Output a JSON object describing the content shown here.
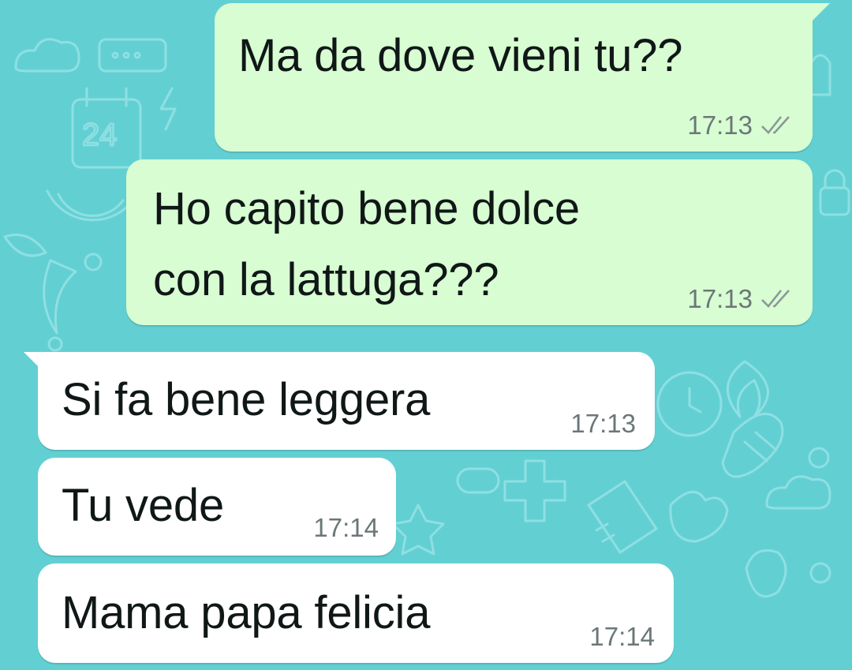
{
  "wallpaper": {
    "background": "#62d0d3",
    "doodle_color": "#8fdfe2",
    "doodles": [
      "calendar-icon",
      "cloud-icon",
      "lightning-icon",
      "watermelon-icon",
      "chili-icon",
      "clock-icon",
      "corn-icon",
      "baby-bottle-icon",
      "plus-icon",
      "flame-icon",
      "star-icon",
      "pill-icon",
      "cloud-icon",
      "hand-icon"
    ],
    "calendar_label": "24"
  },
  "messages": [
    {
      "direction": "outgoing",
      "text": "Ma da dove vieni tu??",
      "time": "17:13",
      "status": "read-double-check",
      "bubble_color": "#d8fdd2"
    },
    {
      "direction": "outgoing",
      "text_line1": "Ho capito bene dolce",
      "text_line2": "con la lattuga???",
      "time": "17:13",
      "status": "read-double-check",
      "bubble_color": "#d8fdd2"
    },
    {
      "direction": "incoming",
      "text": "Si fa bene leggera",
      "time": "17:13",
      "bubble_color": "#ffffff"
    },
    {
      "direction": "incoming",
      "text": "Tu vede",
      "time": "17:14",
      "bubble_color": "#ffffff"
    },
    {
      "direction": "incoming",
      "text": "Mama papa felicia",
      "time": "17:14",
      "bubble_color": "#ffffff"
    }
  ]
}
